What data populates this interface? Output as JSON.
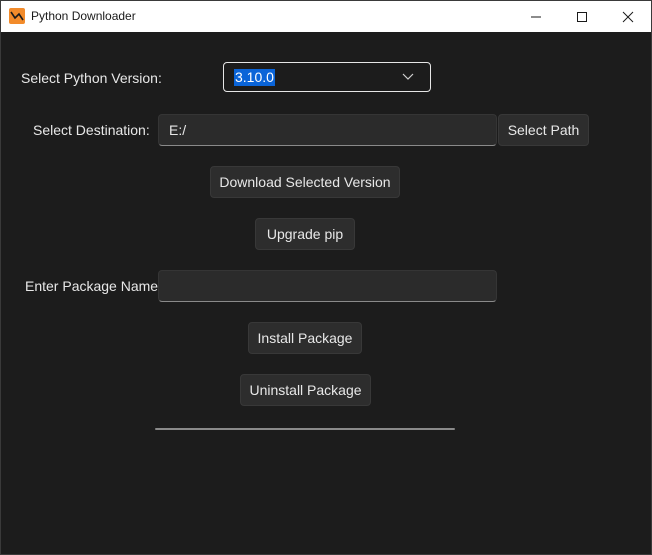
{
  "window": {
    "title": "Python Downloader",
    "icon": "python-downloader-app-icon",
    "controls": [
      "minimize-icon",
      "maximize-icon",
      "close-icon"
    ]
  },
  "version": {
    "label": "Select Python Version:",
    "selected": "3.10.0"
  },
  "destination": {
    "label": "Select Destination:",
    "value": "E:/",
    "button": "Select Path"
  },
  "actions": {
    "download": "Download Selected Version",
    "upgrade_pip": "Upgrade pip"
  },
  "package": {
    "label": "Enter Package Name:",
    "value": "",
    "install": "Install Package",
    "uninstall": "Uninstall Package"
  },
  "progress": {
    "fraction": 0
  },
  "colors": {
    "background": "#1c1c1c",
    "button": "#2d2d2d",
    "selection": "#0a64d8",
    "text": "#e8e8e8"
  }
}
